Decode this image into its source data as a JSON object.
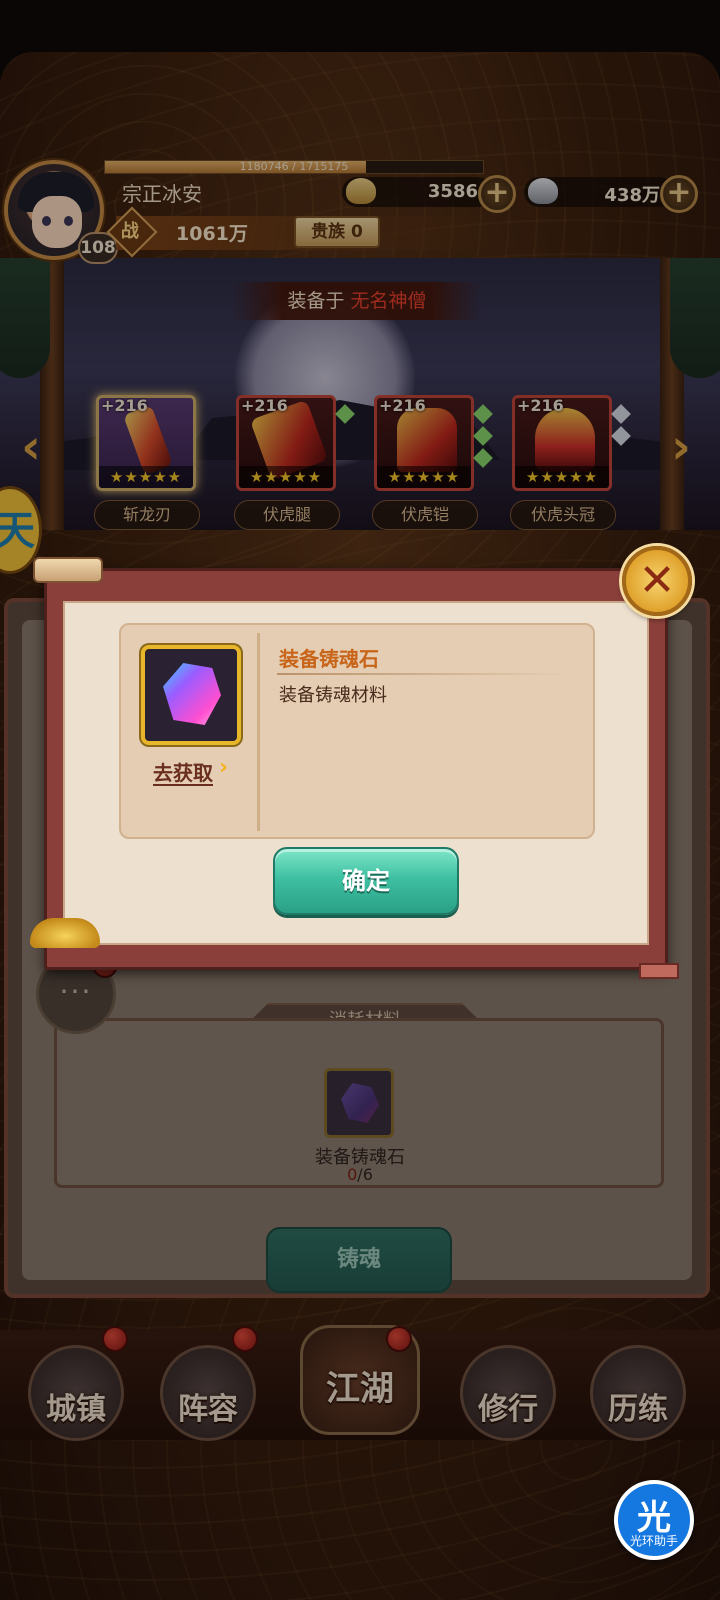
{
  "player": {
    "name": "宗正冰安",
    "level": "108",
    "exp_text": "1180746 / 1715175",
    "exp_fraction": 0.69,
    "power_label": "战",
    "power_value": "1061万",
    "noble_label": "贵族 0"
  },
  "currencies": [
    {
      "name": "gold-ingot",
      "value": "3586",
      "color": "#c8a050"
    },
    {
      "name": "silver-ingot",
      "value": "438万",
      "color": "#c0c4cc"
    }
  ],
  "scene": {
    "equipped_prefix": "装备于",
    "equipped_name": "无名神僧"
  },
  "equipment_slots": [
    {
      "plus": "+216",
      "stars": "★★★★★",
      "name": "斩龙刃"
    },
    {
      "plus": "+216",
      "stars": "★★★★★",
      "name": "伏虎腿"
    },
    {
      "plus": "+216",
      "stars": "★★★★★",
      "name": "伏虎铠"
    },
    {
      "plus": "+216",
      "stars": "★★★★★",
      "name": "伏虎头冠"
    }
  ],
  "side_bubble": "天",
  "dialog": {
    "item_name": "装备铸魂石",
    "item_desc": "装备铸魂材料",
    "get_link": "去获取",
    "confirm": "确定",
    "close_icon": "close-x-icon"
  },
  "consume": {
    "title": "消耗材料",
    "item_name": "装备铸魂石",
    "count_have": "0",
    "count_need": "/6",
    "forge_button": "铸魂"
  },
  "chat_icon": "···",
  "bottom_nav": [
    {
      "label": "城镇"
    },
    {
      "label": "阵容"
    },
    {
      "label": "江湖"
    },
    {
      "label": "修行"
    },
    {
      "label": "历练"
    }
  ],
  "helper": {
    "glyph": "光",
    "label": "光环助手"
  }
}
